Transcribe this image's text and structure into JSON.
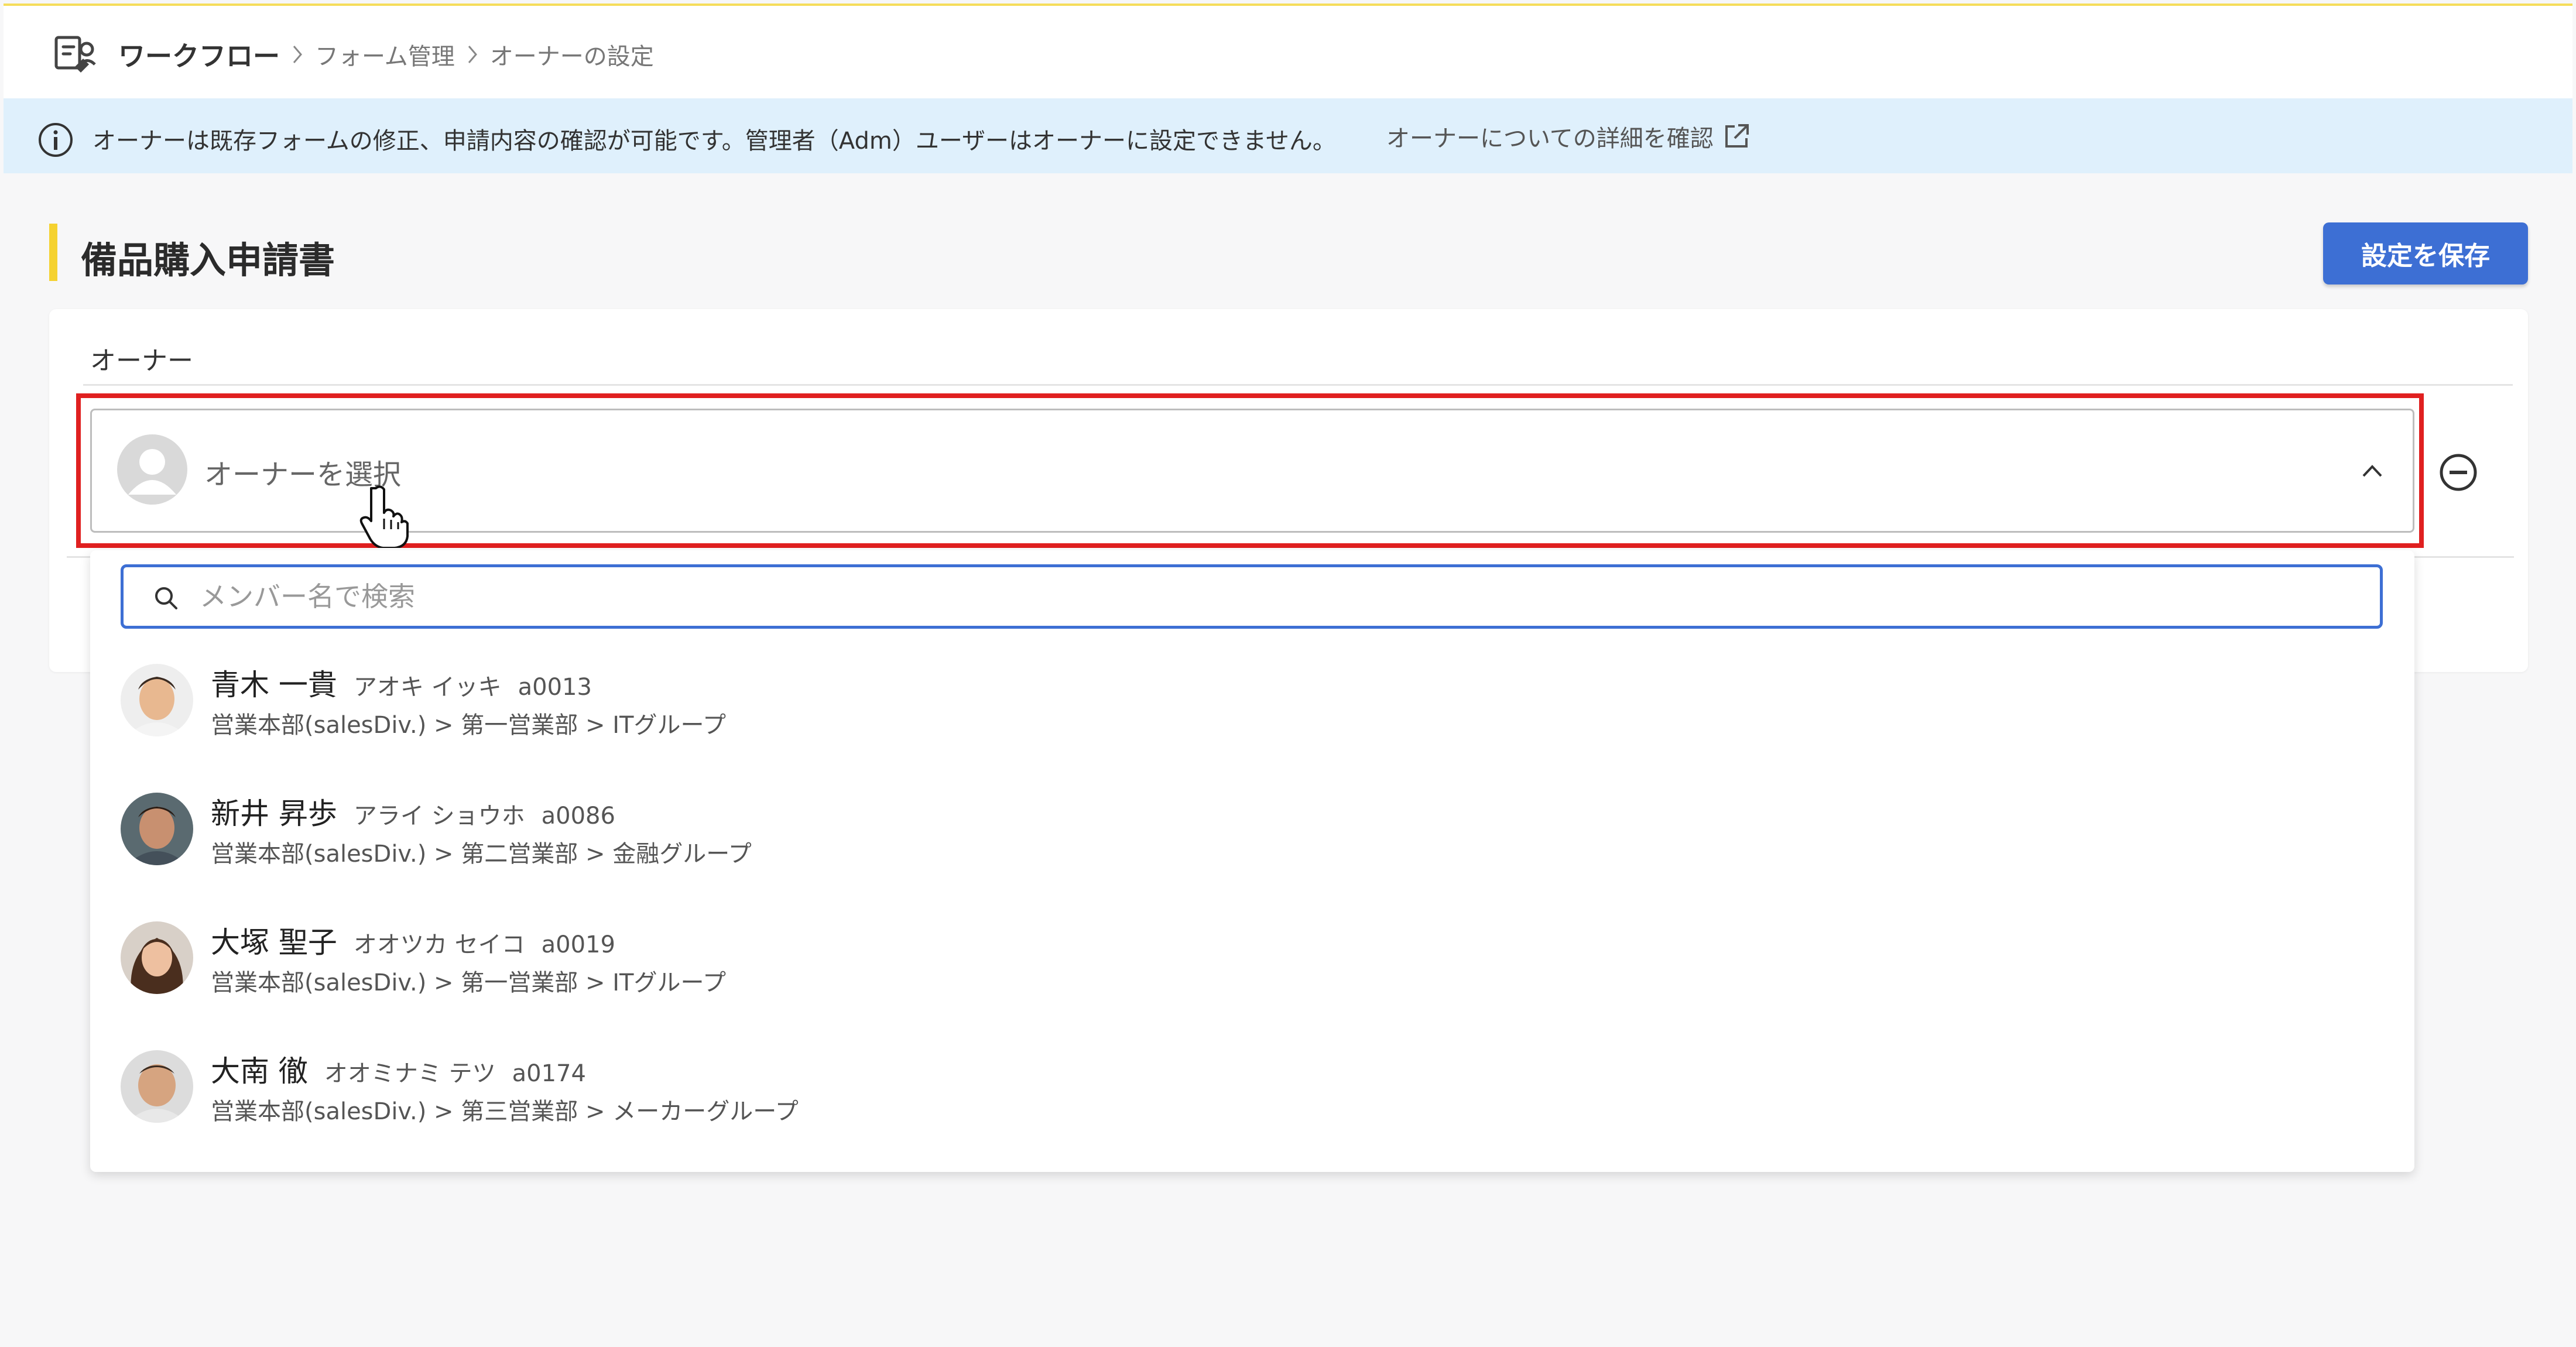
{
  "breadcrumb": {
    "app": "ワークフロー",
    "items": [
      "フォーム管理",
      "オーナーの設定"
    ]
  },
  "info": {
    "text": "オーナーは既存フォームの修正、申請内容の確認が可能です。管理者（Adm）ユーザーはオーナーに設定できません。",
    "link": "オーナーについての詳細を確認"
  },
  "page": {
    "title": "備品購入申請書",
    "save_label": "設定を保存"
  },
  "owner_card": {
    "label": "オーナー",
    "selector_placeholder": "オーナーを選択"
  },
  "dropdown": {
    "search_placeholder": "メンバー名で検索",
    "members": [
      {
        "name": "青木 一貴",
        "kana": "アオキ イッキ",
        "code": "a0013",
        "dept": "営業本部(salesDiv.) > 第一営業部 > ITグループ"
      },
      {
        "name": "新井 昇歩",
        "kana": "アライ ショウホ",
        "code": "a0086",
        "dept": "営業本部(salesDiv.) > 第二営業部 > 金融グループ"
      },
      {
        "name": "大塚 聖子",
        "kana": "オオツカ セイコ",
        "code": "a0019",
        "dept": "営業本部(salesDiv.) > 第一営業部 > ITグループ"
      },
      {
        "name": "大南 徹",
        "kana": "オオミナミ テツ",
        "code": "a0174",
        "dept": "営業本部(salesDiv.) > 第三営業部 > メーカーグループ"
      }
    ]
  },
  "colors": {
    "accent": "#3d6fd4",
    "highlight": "#e02020",
    "title_accent": "#f5d230",
    "info_bg": "#dff0fc"
  }
}
